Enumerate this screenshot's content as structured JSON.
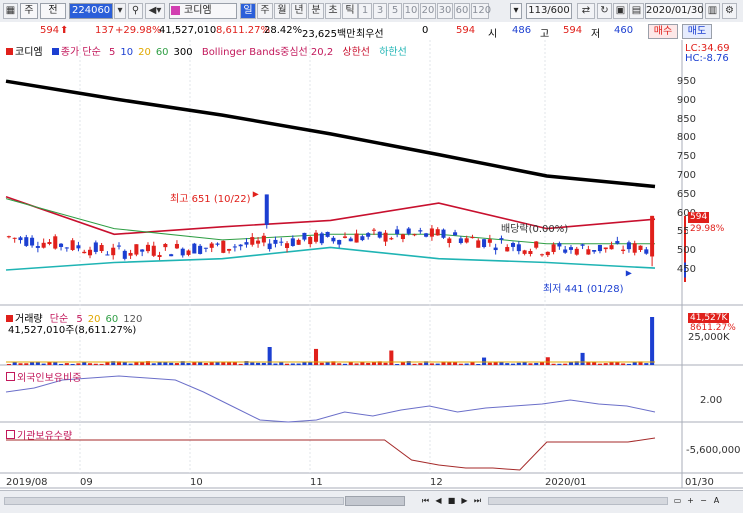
{
  "toolbar": {
    "code": "224060",
    "stock_name": "코디엠",
    "periods": [
      "일",
      "주",
      "월",
      "년",
      "분",
      "초",
      "틱"
    ],
    "minutes": [
      "1",
      "3",
      "5",
      "10",
      "20",
      "30",
      "60",
      "120"
    ],
    "count": "113/600",
    "date": "2020/01/30",
    "type_label": "주",
    "chart_label": "전"
  },
  "quote": {
    "price": "594",
    "change": "137",
    "change_pct": "+29.98%",
    "volume": "41,527,010",
    "volume_pct": "8,611.27%",
    "turnover_pct": "28.42%",
    "amount": "23,625백만",
    "prev_label": "최우선",
    "prev_value": "0",
    "close_value": "594",
    "open_label": "시",
    "open_value": "486",
    "high_label": "고",
    "high_value": "594",
    "low_label": "저",
    "low_value": "460",
    "buy_label": "매수",
    "sell_label": "매도"
  },
  "price_panel": {
    "legend_name": "코디엠",
    "ma_label": "종가 단순",
    "ma_periods": [
      "5",
      "10",
      "20",
      "60",
      "300"
    ],
    "bb_label": "Bollinger Bands중심선 20,2",
    "upper_label": "상한선",
    "lower_label": "하한선",
    "lc": "LC:34.69",
    "hc": "HC:-8.76",
    "y_ticks": [
      "950",
      "900",
      "850",
      "800",
      "750",
      "700",
      "650",
      "600",
      "550",
      "500",
      "450"
    ],
    "high_annotation": "최고 651 (10/22)",
    "low_annotation": "최저 441 (01/28)",
    "dividend_annotation": "배당락(0.00%)",
    "price_tag": "594",
    "pct_tag": "29.98%"
  },
  "volume_panel": {
    "legend_name": "거래량",
    "ma_label": "단순",
    "ma_periods": [
      "5",
      "20",
      "60",
      "120"
    ],
    "value_line": "41,527,010주(8,611.27%)",
    "tag_value": "41,527K",
    "tag_pct": "8611.27%",
    "y_tick": "25,000K"
  },
  "foreign_panel": {
    "legend_name": "외국인보유비중",
    "y_tick": "2.00"
  },
  "inst_panel": {
    "legend_name": "기관보유수량",
    "y_tick": "-5,600,000"
  },
  "x_axis": {
    "labels": [
      "2019/08",
      "09",
      "10",
      "11",
      "12",
      "2020/01",
      "01/30"
    ]
  },
  "colors": {
    "up": "#e0201b",
    "down": "#1c3fd1",
    "ma300": "#000000",
    "bb_upper": "#c8102e",
    "bb_lower": "#1fb4b4",
    "ma20": "#2f9e44"
  },
  "chart_data": {
    "type": "line",
    "title": "코디엠",
    "x": [
      "2019/08",
      "09",
      "10",
      "11",
      "12",
      "2020/01",
      "01/30"
    ],
    "ylim": [
      420,
      980
    ],
    "series": [
      {
        "name": "300",
        "values": [
          952,
          905,
          862,
          812,
          757,
          700,
          672
        ]
      },
      {
        "name": "상한선",
        "values": [
          645,
          545,
          565,
          582,
          628,
          560,
          585
        ]
      },
      {
        "name": "하한선",
        "values": [
          450,
          470,
          480,
          510,
          480,
          470,
          455
        ]
      },
      {
        "name": "20",
        "values": [
          640,
          560,
          530,
          545,
          545,
          520,
          520
        ]
      }
    ],
    "close_last": 594,
    "high": {
      "value": 651,
      "date": "10/22"
    },
    "low": {
      "value": 441,
      "date": "01/28"
    }
  }
}
